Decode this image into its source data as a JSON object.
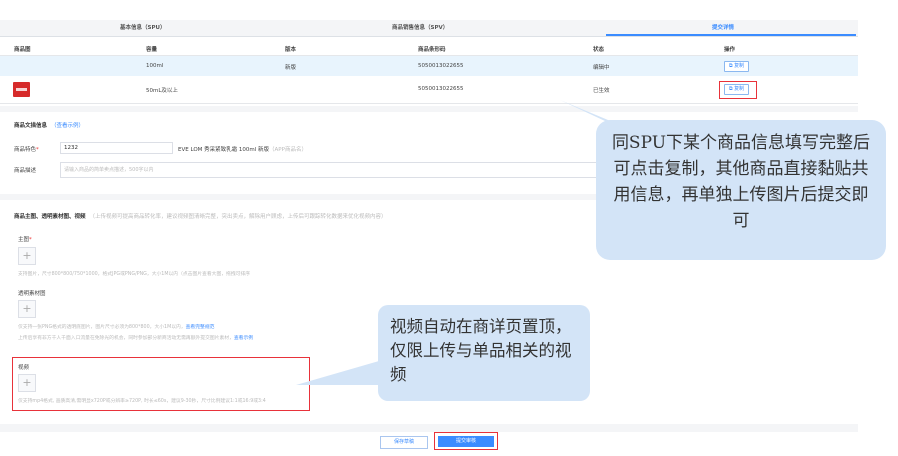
{
  "tabs": {
    "spu": "基本信息（SPU）",
    "spv": "商品销售信息（SPV）",
    "submit_details": "提交详情"
  },
  "table": {
    "headers": [
      "商品图",
      "容量",
      "版本",
      "商品条形码",
      "状态",
      "操作"
    ],
    "rows": [
      {
        "capacity": "100ml",
        "version": "新版",
        "barcode": "5050013022655",
        "status": "编辑中",
        "action": "复制"
      },
      {
        "capacity": "50mL及以上",
        "version": "",
        "barcode": "5050013022655",
        "status": "已生效",
        "action": "复制"
      }
    ]
  },
  "copy_section": {
    "title": "商品文描信息",
    "hint": "（查看示例）",
    "feature_label": "商品特色",
    "feature_required": "*",
    "feature_value": "1232",
    "feature_preview": "EVE LOM 秀采紧致乳霜 100ml 新版",
    "feature_preview_hint": "（APP商品名）",
    "desc_label": "商品描述",
    "desc_placeholder": "请输入商品的简单卖点描述，500字以内"
  },
  "media_section": {
    "title": "商品主图、透明素材图、视频",
    "hint": "（上传视频可提高商品转化率，建议视频图清晰完整，突出卖点，解除用户顾虑，上传后可跟踪转化数据来优化视频内容）",
    "main_label": "主图",
    "main_required": "*",
    "main_note": "支持图片，尺寸800*800/750*1000，格式JPG或PNG/PNG，大小1M以内（点击图片查看大图，拖拽可排序",
    "transparent_label": "透明素材图",
    "transparent_note": "仅支持一张PNG格式的透明底图片，图片尺寸必须为800*800，大小1M以内，",
    "transparent_link": "查看完整规范",
    "transparent_note2": "上传后享有非方千人千面入口流量在免除光的机会，同时参加部分新商活动无需再额外提交图片素材，",
    "transparent_link2": "查看示例",
    "video_label": "视频",
    "video_note": "仅支持mp4格式, 画质高清,需明显x720P或分辨率≥720P, 时长≤60s，建议9-30秒，尺寸比例建议1:1或16:9或3:4"
  },
  "callouts": {
    "copy_tip": "同SPU下某个商品信息填写完整后可点击复制，其他商品直接黏贴共用信息，再单独上传图片后提交即可",
    "video_tip": "视频自动在商详页置顶，仅限上传与单品相关的视频"
  },
  "buttons": {
    "save_draft": "保存草稿",
    "submit_review": "提交审核"
  },
  "icons": {
    "plus": "+",
    "copy": "⧉"
  }
}
